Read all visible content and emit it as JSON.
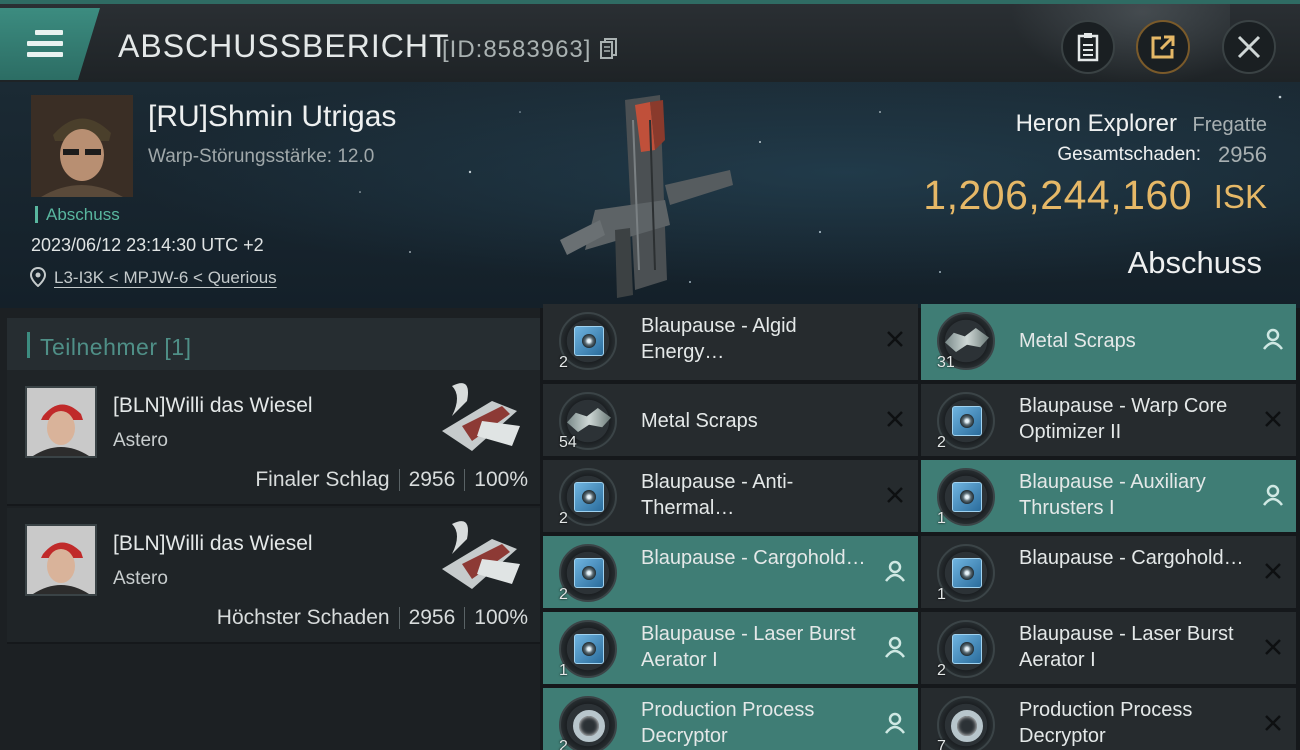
{
  "titlebar": {
    "title": "ABSCHUSSBERICHT",
    "id_text": "[ID:8583963]",
    "icons": [
      "menu-icon",
      "copy-icon",
      "clipboard-icon",
      "share-icon",
      "close-icon"
    ],
    "accent_color": "#3c8c80"
  },
  "victim": {
    "name": "[RU]Shmin Utrigas",
    "warp_disruption": "Warp-Störungsstärke: 12.0",
    "kill_tag": "Abschuss",
    "datetime": "2023/06/12 23:14:30 UTC +2",
    "location": "L3-I3K < MPJW-6 < Querious"
  },
  "ship": {
    "name": "Heron Explorer",
    "class": "Fregatte",
    "damage_label": "Gesamtschaden:",
    "damage_value": "2956",
    "isk_value": "1,206,244,160",
    "isk_unit": "ISK",
    "result": "Abschuss",
    "isk_color": "#e6b867"
  },
  "participants": {
    "title": "Teilnehmer [1]",
    "rows": [
      {
        "name": "[BLN]Willi das Wiesel",
        "ship": "Astero",
        "role": "Finaler Schlag",
        "damage": "2956",
        "percent": "100%"
      },
      {
        "name": "[BLN]Willi das Wiesel",
        "ship": "Astero",
        "role": "Höchster Schaden",
        "damage": "2956",
        "percent": "100%"
      }
    ]
  },
  "items_left": [
    {
      "name": "Blaupause - Algid Energy…",
      "qty": "2",
      "dropped": false,
      "icon": "blueprint-icon"
    },
    {
      "name": "Metal Scraps",
      "qty": "54",
      "dropped": false,
      "icon": "scrap-icon"
    },
    {
      "name": "Blaupause - Anti-Thermal…",
      "qty": "2",
      "dropped": false,
      "icon": "blueprint-icon"
    },
    {
      "name": "Blaupause - Cargohold…",
      "qty": "2",
      "dropped": true,
      "icon": "blueprint-icon"
    },
    {
      "name": "Blaupause - Laser Burst Aerator I",
      "qty": "1",
      "dropped": true,
      "icon": "blueprint-icon"
    },
    {
      "name": "Production Process Decryptor",
      "qty": "2",
      "dropped": true,
      "icon": "decryptor-icon"
    }
  ],
  "items_right": [
    {
      "name": "Metal Scraps",
      "qty": "31",
      "dropped": true,
      "icon": "scrap-icon"
    },
    {
      "name": "Blaupause - Warp Core Optimizer II",
      "qty": "2",
      "dropped": false,
      "icon": "blueprint-icon"
    },
    {
      "name": "Blaupause - Auxiliary Thrusters I",
      "qty": "1",
      "dropped": true,
      "icon": "blueprint-icon"
    },
    {
      "name": "Blaupause - Cargohold…",
      "qty": "1",
      "dropped": false,
      "icon": "blueprint-icon"
    },
    {
      "name": "Blaupause - Laser Burst Aerator I",
      "qty": "2",
      "dropped": false,
      "icon": "blueprint-icon"
    },
    {
      "name": "Production Process Decryptor",
      "qty": "7",
      "dropped": false,
      "icon": "decryptor-icon"
    }
  ]
}
